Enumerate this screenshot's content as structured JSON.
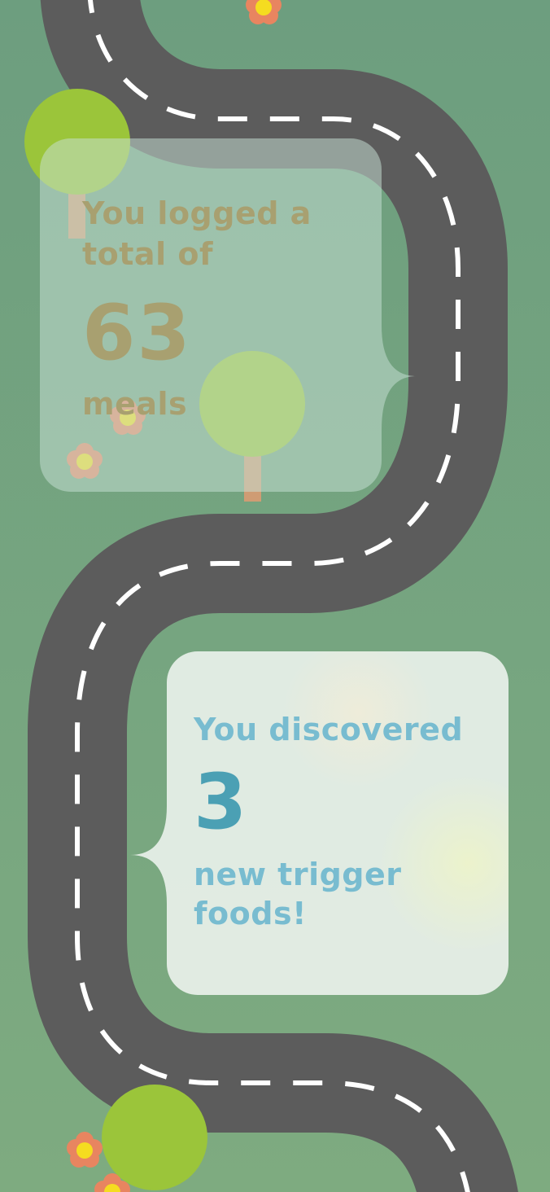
{
  "colors": {
    "grass": "#74a584",
    "road": "#5c5c5c",
    "lane": "#ffffff",
    "tree_canopy": "#9bc53a",
    "tree_trunk": "#cf9c74",
    "flower_petal": "#e88560",
    "flower_center": "#f5dc20",
    "meals_text": "#a8a070",
    "trigger_text": "#78bcd0",
    "trigger_number": "#4ba0b4"
  },
  "meals_card": {
    "line1": "You logged a",
    "line2": "total of",
    "number": "63",
    "unit": "meals"
  },
  "trigger_card": {
    "line1": "You discovered",
    "number": "3",
    "line2": "new trigger",
    "line3": "foods!"
  }
}
